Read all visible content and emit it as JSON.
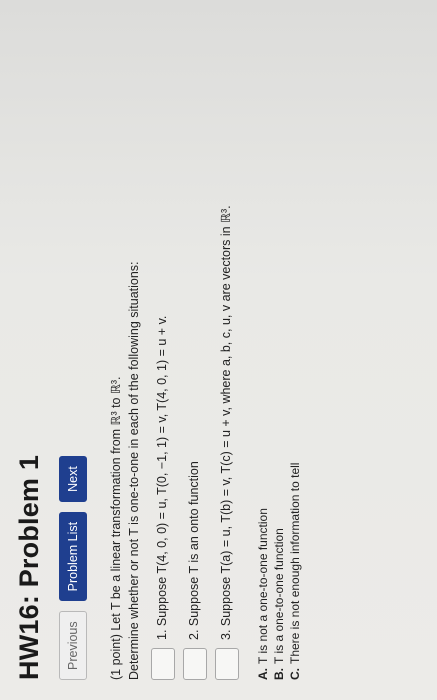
{
  "title": "HW16: Problem 1",
  "nav": {
    "previous": "Previous",
    "problem_list": "Problem List",
    "next": "Next"
  },
  "problem": {
    "points": "(1 point)",
    "statement": "Let T be a linear transformation from ℝ³ to ℝ³.",
    "instruction": "Determine whether or not T is one-to-one in each of the following situations:",
    "items": [
      "1. Suppose T(4, 0, 0) = u, T(0, −1, 1) = v, T(4, 0, 1) = u + v.",
      "2. Suppose T is an onto function",
      "3. Suppose T(a) = u, T(b) = v, T(c) = u + v, where a, b, c, u, v are vectors in ℝ³."
    ],
    "options": [
      {
        "letter": "A.",
        "text": "T is not a one-to-one function"
      },
      {
        "letter": "B.",
        "text": "T is a one-to-one function"
      },
      {
        "letter": "C.",
        "text": "There is not enough information to tell"
      }
    ]
  }
}
